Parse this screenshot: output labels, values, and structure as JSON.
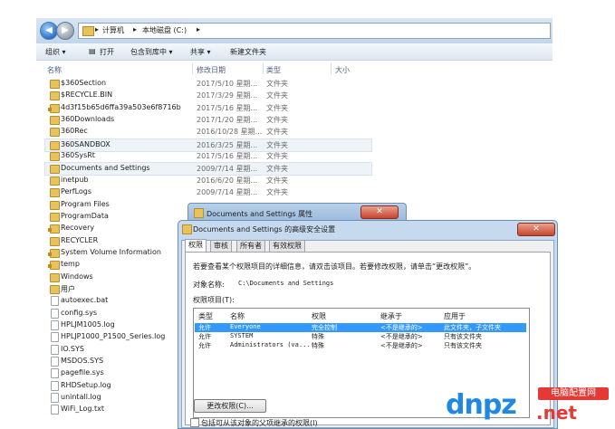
{
  "address": {
    "path": [
      "计算机",
      "本地磁盘 (C:)"
    ]
  },
  "toolbar": {
    "organize": "组织 ▾",
    "open": "打开",
    "include": "包含到库中 ▾",
    "share": "共享 ▾",
    "new_folder": "新建文件夹"
  },
  "columns": {
    "name": "名称",
    "date": "修改日期",
    "type": "类型",
    "size": "大小"
  },
  "files": [
    {
      "name": "$360Section",
      "date": "2017/5/10 星期...",
      "type": "文件夹",
      "kind": "folder"
    },
    {
      "name": "$RECYCLE.BIN",
      "date": "2017/3/29 星期...",
      "type": "文件夹",
      "kind": "folder"
    },
    {
      "name": "4d3f15b65d6ffa39a503e6f8716b",
      "date": "2017/5/16 星期...",
      "type": "文件夹",
      "kind": "folder"
    },
    {
      "name": "360Downloads",
      "date": "2017/1/20 星期...",
      "type": "文件夹",
      "kind": "folder"
    },
    {
      "name": "360Rec",
      "date": "2016/10/28 星期...",
      "type": "文件夹",
      "kind": "folder"
    },
    {
      "name": "360SANDBOX",
      "date": "2016/3/25 星期...",
      "type": "文件夹",
      "kind": "folder"
    },
    {
      "name": "360SysRt",
      "date": "2017/5/16 星期...",
      "type": "文件夹",
      "kind": "folder"
    },
    {
      "name": "Documents and Settings",
      "date": "2009/7/14 星期...",
      "type": "文件夹",
      "kind": "folder"
    },
    {
      "name": "inetpub",
      "date": "2016/6/20 星期...",
      "type": "文件夹",
      "kind": "folder"
    },
    {
      "name": "PerfLogs",
      "date": "2009/7/14 星期...",
      "type": "文件夹",
      "kind": "folder"
    },
    {
      "name": "Program Files",
      "date": "",
      "type": "",
      "kind": "folder"
    },
    {
      "name": "ProgramData",
      "date": "",
      "type": "",
      "kind": "folder"
    },
    {
      "name": "Recovery",
      "date": "",
      "type": "",
      "kind": "folder"
    },
    {
      "name": "RECYCLER",
      "date": "",
      "type": "",
      "kind": "folder"
    },
    {
      "name": "System Volume Information",
      "date": "",
      "type": "",
      "kind": "folder"
    },
    {
      "name": "temp",
      "date": "",
      "type": "",
      "kind": "folder"
    },
    {
      "name": "Windows",
      "date": "",
      "type": "",
      "kind": "folder"
    },
    {
      "name": "用户",
      "date": "",
      "type": "",
      "kind": "folder"
    },
    {
      "name": "autoexec.bat",
      "date": "",
      "type": "",
      "kind": "file"
    },
    {
      "name": "config.sys",
      "date": "",
      "type": "",
      "kind": "file"
    },
    {
      "name": "HPLJM1005.log",
      "date": "",
      "type": "",
      "kind": "file"
    },
    {
      "name": "HPLJP1000_P1500_Series.log",
      "date": "",
      "type": "",
      "kind": "file"
    },
    {
      "name": "IO.SYS",
      "date": "",
      "type": "",
      "kind": "file"
    },
    {
      "name": "MSDOS.SYS",
      "date": "",
      "type": "",
      "kind": "file"
    },
    {
      "name": "pagefile.sys",
      "date": "",
      "type": "",
      "kind": "file"
    },
    {
      "name": "RHDSetup.log",
      "date": "",
      "type": "",
      "kind": "file"
    },
    {
      "name": "unintall.log",
      "date": "",
      "type": "",
      "kind": "file"
    },
    {
      "name": "WiFi_Log.txt",
      "date": "",
      "type": "",
      "kind": "file"
    }
  ],
  "prop_dialog": {
    "title": "Documents and Settings 属性",
    "close": "✕"
  },
  "adv_dialog": {
    "title": "Documents and Settings 的高级安全设置",
    "close": "✕",
    "tabs": [
      "权限",
      "审核",
      "所有者",
      "有效权限"
    ],
    "info": "若要查看某个权限项目的详细信息，请双击该项目。若要修改权限，请单击“更改权限”。",
    "object_label": "对象名称:",
    "object_value": "C:\\Documents and Settings",
    "entries_label": "权限项目(T):",
    "headers": {
      "type": "类型",
      "name": "名称",
      "perm": "权限",
      "inherit": "继承于",
      "apply": "应用于"
    },
    "entries": [
      {
        "type": "允许",
        "name": "Everyone",
        "perm": "完全控制",
        "inherit": "<不是继承的>",
        "apply": "此文件夹，子文件夹"
      },
      {
        "type": "允许",
        "name": "SYSTEM",
        "perm": "特殊",
        "inherit": "<不是继承的>",
        "apply": "只有该文件夹"
      },
      {
        "type": "允许",
        "name": "Administrators (va...",
        "perm": "特殊",
        "inherit": "<不是继承的>",
        "apply": "只有该文件夹"
      }
    ],
    "change_button": "更改权限(C)...",
    "inherit_check": "包括可从该对象的父项继承的权限(I)"
  },
  "logo": {
    "big": "dnpz.net",
    "badge": "电脑配置网",
    "domain": ".net"
  }
}
